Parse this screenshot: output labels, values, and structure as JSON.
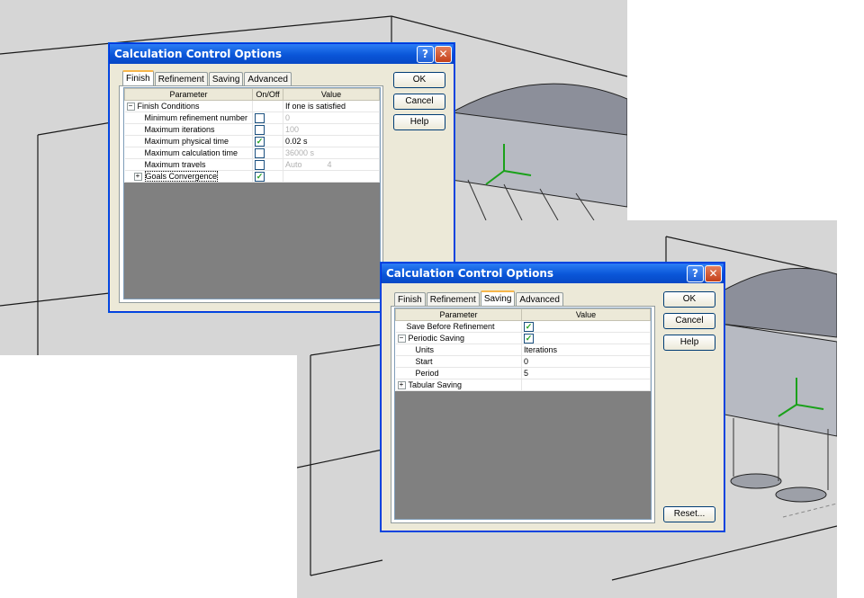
{
  "dialog1": {
    "title": "Calculation Control Options",
    "help_glyph": "?",
    "close_glyph": "✕",
    "tabs": [
      "Finish",
      "Refinement",
      "Saving",
      "Advanced"
    ],
    "active_tab": "Finish",
    "columns": [
      "Parameter",
      "On/Off",
      "Value"
    ],
    "rows": [
      {
        "name": "Finish Conditions",
        "expander": "−",
        "value": "If one is satisfied"
      },
      {
        "name": "Minimum refinement number",
        "checked": false,
        "value": "0"
      },
      {
        "name": "Maximum iterations",
        "checked": false,
        "value": "100"
      },
      {
        "name": "Maximum physical time",
        "checked": true,
        "value": "0.02 s"
      },
      {
        "name": "Maximum calculation time",
        "checked": false,
        "value": "36000 s"
      },
      {
        "name": "Maximum travels",
        "checked": false,
        "value": "Auto",
        "value2": "4"
      },
      {
        "name": "Goals Convergence",
        "expander": "+",
        "checked": true,
        "value": ""
      }
    ],
    "buttons": {
      "ok": "OK",
      "cancel": "Cancel",
      "help": "Help"
    }
  },
  "dialog2": {
    "title": "Calculation Control Options",
    "help_glyph": "?",
    "close_glyph": "✕",
    "tabs": [
      "Finish",
      "Refinement",
      "Saving",
      "Advanced"
    ],
    "active_tab": "Saving",
    "columns": [
      "Parameter",
      "Value"
    ],
    "rows": [
      {
        "name": "Save Before Refinement",
        "checked": true
      },
      {
        "name": "Periodic Saving",
        "expander": "−",
        "checked": true
      },
      {
        "name": "Units",
        "value": "Iterations"
      },
      {
        "name": "Start",
        "value": "0"
      },
      {
        "name": "Period",
        "value": "5"
      },
      {
        "name": "Tabular Saving",
        "expander": "+"
      }
    ],
    "buttons": {
      "ok": "OK",
      "cancel": "Cancel",
      "help": "Help",
      "reset": "Reset..."
    }
  },
  "colors": {
    "title_blue": "#0a56d8",
    "check_green": "#21a121",
    "tab_highlight": "#f7b64b",
    "grid_empty": "#808080"
  }
}
